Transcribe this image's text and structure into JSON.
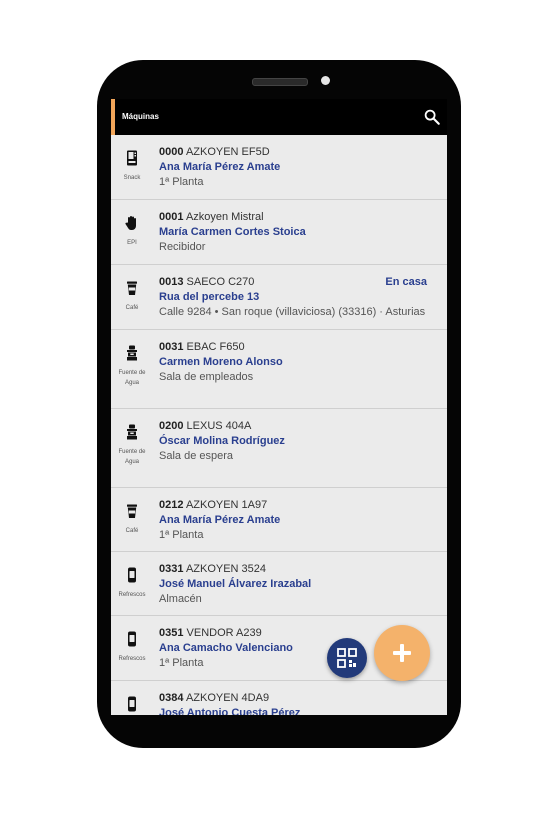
{
  "appbar": {
    "title": "Máquinas",
    "search_icon": "search-icon"
  },
  "machines": [
    {
      "code": "0000",
      "model": "AZKOYEN EF5D",
      "person": "Ana María Pérez Amate",
      "location": "1ª Planta",
      "category": "Snack",
      "icon": "snack-machine-icon",
      "badge": ""
    },
    {
      "code": "0001",
      "model": "Azkoyen Mistral",
      "person": "María Carmen Cortes Stoica",
      "location": "Recibidor",
      "category": "EPI",
      "icon": "glove-icon",
      "badge": ""
    },
    {
      "code": "0013",
      "model": "SAECO C270",
      "person": "Rua del percebe 13",
      "location": "Calle 9284 • San roque (villaviciosa) (33316) · Asturias",
      "category": "Café",
      "icon": "coffee-cup-icon",
      "badge": "En casa"
    },
    {
      "code": "0031",
      "model": "EBAC F650",
      "person": "Carmen Moreno Alonso",
      "location": "Sala de empleados",
      "category": "Fuente de Agua",
      "icon": "water-fountain-icon",
      "badge": ""
    },
    {
      "code": "0200",
      "model": "LEXUS 404A",
      "person": "Óscar Molina Rodríguez",
      "location": "Sala de espera",
      "category": "Fuente de Agua",
      "icon": "water-fountain-icon",
      "badge": ""
    },
    {
      "code": "0212",
      "model": "AZKOYEN 1A97",
      "person": "Ana María Pérez Amate",
      "location": "1ª Planta",
      "category": "Café",
      "icon": "coffee-cup-icon",
      "badge": ""
    },
    {
      "code": "0331",
      "model": "AZKOYEN 3524",
      "person": "José Manuel Álvarez Irazabal",
      "location": "Almacén",
      "category": "Refrescos",
      "icon": "soda-can-icon",
      "badge": ""
    },
    {
      "code": "0351",
      "model": "VENDOR A239",
      "person": "Ana Camacho Valenciano",
      "location": "1ª Planta",
      "category": "Refrescos",
      "icon": "soda-can-icon",
      "badge": ""
    },
    {
      "code": "0384",
      "model": "AZKOYEN 4DA9",
      "person": "José Antonio Cuesta Pérez",
      "location": "",
      "category": "",
      "icon": "soda-can-icon",
      "badge": ""
    }
  ],
  "fabs": {
    "scan": "qr-scan-icon",
    "add": "plus-icon"
  },
  "colors": {
    "accent": "#f2a65a",
    "link": "#2a3f8f",
    "fab_scan": "#223a7a",
    "fab_add": "#f4b26b"
  }
}
